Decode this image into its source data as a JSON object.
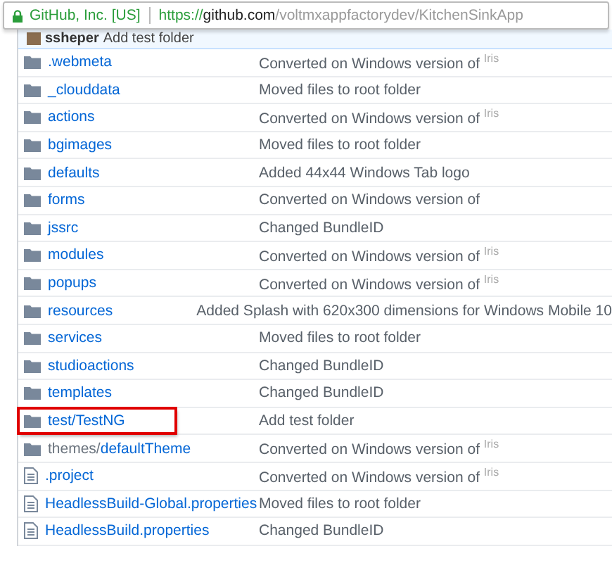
{
  "address_bar": {
    "site_identity": "GitHub, Inc. [US]",
    "url_scheme": "https://",
    "url_host": "github.com",
    "url_path": "/voltmxappfactorydev/KitchenSinkApp"
  },
  "commit": {
    "author": "ssheper",
    "message": "Add test folder"
  },
  "files": [
    {
      "kind": "dir",
      "name": ".webmeta",
      "message": "Converted on Windows version of $^{Iris}$",
      "highlighted": false
    },
    {
      "kind": "dir",
      "name": "_clouddata",
      "message": "Moved files to root folder",
      "highlighted": false
    },
    {
      "kind": "dir",
      "name": "actions",
      "message": "Converted on Windows version of $^{Iris}$",
      "highlighted": false
    },
    {
      "kind": "dir",
      "name": "bgimages",
      "message": "Moved files to root folder",
      "highlighted": false
    },
    {
      "kind": "dir",
      "name": "defaults",
      "message": "Added 44x44 Windows Tab logo",
      "highlighted": false
    },
    {
      "kind": "dir",
      "name": "forms",
      "message": "Converted on Windows version of",
      "highlighted": false
    },
    {
      "kind": "dir",
      "name": "jssrc",
      "message": "Changed BundleID",
      "highlighted": false
    },
    {
      "kind": "dir",
      "name": "modules",
      "message": "Converted on Windows version of $^{Iris}$",
      "highlighted": false
    },
    {
      "kind": "dir",
      "name": "popups",
      "message": "Converted on Windows version of $^{Iris}$",
      "highlighted": false
    },
    {
      "kind": "dir",
      "name": "resources",
      "message": "Added Splash with 620x300 dimensions for Windows Mobile 10",
      "highlighted": false
    },
    {
      "kind": "dir",
      "name": "services",
      "message": "Moved files to root folder",
      "highlighted": false
    },
    {
      "kind": "dir",
      "name": "studioactions",
      "message": "Changed BundleID",
      "highlighted": false
    },
    {
      "kind": "dir",
      "name": "templates",
      "message": "Changed BundleID",
      "highlighted": false
    },
    {
      "kind": "dir",
      "name": "test/TestNG",
      "message": "Add test folder",
      "highlighted": true
    },
    {
      "kind": "dir",
      "path_prefix": "themes/",
      "name": "defaultTheme",
      "message": "Converted on Windows version of $^{Iris}$",
      "highlighted": false
    },
    {
      "kind": "file",
      "name": ".project",
      "message": "Converted on Windows version of $^{Iris}$",
      "highlighted": false
    },
    {
      "kind": "file",
      "name": "HeadlessBuild-Global.properties",
      "message": "Moved files to root folder",
      "highlighted": false
    },
    {
      "kind": "file",
      "name": "HeadlessBuild.properties",
      "message": "Changed BundleID",
      "highlighted": false
    }
  ]
}
